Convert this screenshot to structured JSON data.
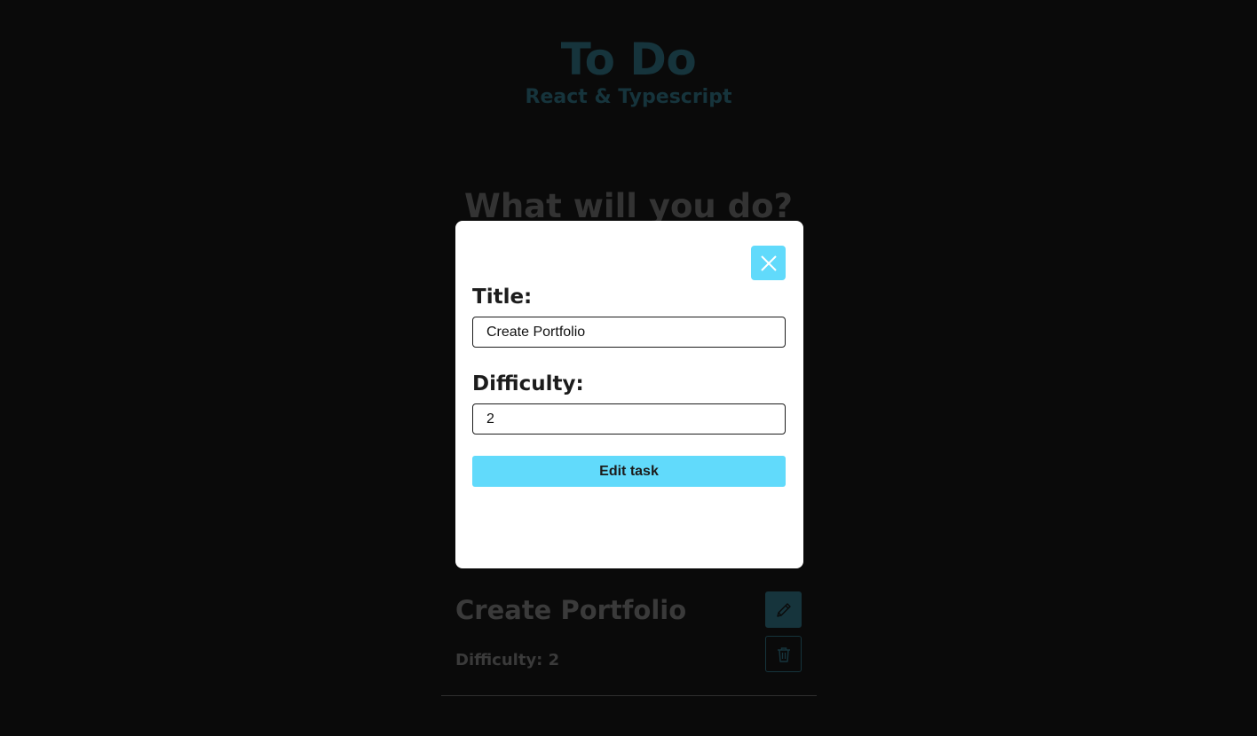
{
  "header": {
    "title": "To Do",
    "subtitle": "React & Typescript"
  },
  "form": {
    "heading": "What will you do?"
  },
  "task_list": {
    "items": [
      {
        "title": "Create Portfolio",
        "difficulty_text": "Difficulty: 2",
        "edit_icon": "pencil-icon",
        "delete_icon": "trash-icon"
      }
    ]
  },
  "modal": {
    "close_icon": "close-icon",
    "title_label": "Title:",
    "title_value": "Create Portfolio",
    "difficulty_label": "Difficulty:",
    "difficulty_value": "2",
    "submit_label": "Edit task"
  },
  "colors": {
    "background": "#0a0a0a",
    "accent": "#61dafb",
    "accent_dim": "#16343c",
    "modal_bg": "#ffffff",
    "text_dark": "#1c1c1c",
    "text_dim": "#3a3a3a"
  }
}
